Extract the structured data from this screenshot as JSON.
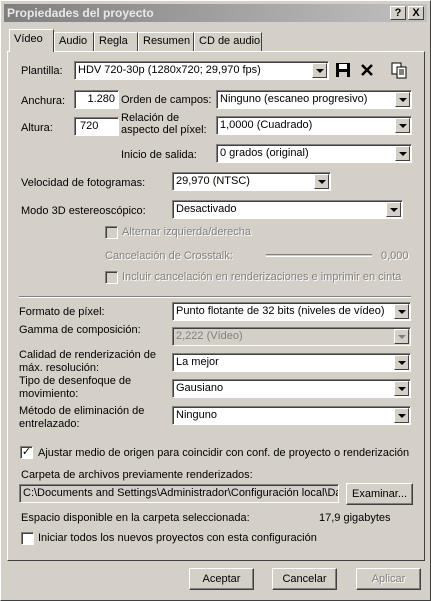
{
  "window": {
    "title": "Propiedades del proyecto",
    "help_label": "?",
    "close_label": "X"
  },
  "tabs": [
    {
      "label": "Vídeo"
    },
    {
      "label": "Audio"
    },
    {
      "label": "Regla"
    },
    {
      "label": "Resumen"
    },
    {
      "label": "CD de audio"
    }
  ],
  "video": {
    "template_label": "Plantilla:",
    "template_value": "HDV 720-30p (1280x720; 29,970 fps)",
    "width_label": "Anchura:",
    "width_value": "1.280",
    "height_label": "Altura:",
    "height_value": "720",
    "field_order_label": "Orden de campos:",
    "field_order_value": "Ninguno (escaneo progresivo)",
    "pixel_aspect_label": "Relación de aspecto del píxel:",
    "pixel_aspect_value": "1,0000 (Cuadrado)",
    "output_rotation_label": "Inicio de salida:",
    "output_rotation_value": "0 grados (original)",
    "frame_rate_label": "Velocidad de fotogramas:",
    "frame_rate_value": "29,970 (NTSC)",
    "stereo_label": "Modo 3D estereoscópico:",
    "stereo_value": "Desactivado",
    "swap_lr_label": "Alternar izquierda/derecha",
    "crosstalk_label": "Cancelación de Crosstalk:",
    "crosstalk_value": "0,000",
    "include_crosstalk_label": "Incluir cancelación en renderizaciones e imprimir en cinta",
    "pixel_format_label": "Formato de píxel:",
    "pixel_format_value": "Punto flotante de 32 bits (niveles de vídeo)",
    "gamma_label": "Gamma de composición:",
    "gamma_value": "2,222 (Vídeo)",
    "quality_label": "Calidad de renderización de máx. resolución:",
    "quality_value": "La mejor",
    "blur_label": "Tipo de desenfoque de movimiento:",
    "blur_value": "Gausiano",
    "deinterlace_label": "Método de eliminación de entrelazado:",
    "deinterlace_value": "Ninguno",
    "adjust_source_label": "Ajustar medio de origen para coincidir con conf. de proyecto o renderización",
    "adjust_source_checked": true,
    "prerender_folder_label": "Carpeta de archivos previamente renderizados:",
    "prerender_folder_value": "C:\\Documents and Settings\\Administrador\\Configuración local\\Da",
    "browse_label": "Examinar...",
    "free_space_label": "Espacio disponible en la carpeta seleccionada:",
    "free_space_value": "17,9 gigabytes",
    "start_all_label": "Iniciar todos los nuevos proyectos con esta configuración",
    "start_all_checked": false
  },
  "buttons": {
    "ok": "Aceptar",
    "cancel": "Cancelar",
    "apply": "Aplicar"
  },
  "icons": [
    "save-icon",
    "delete-icon",
    "copy-icon"
  ]
}
